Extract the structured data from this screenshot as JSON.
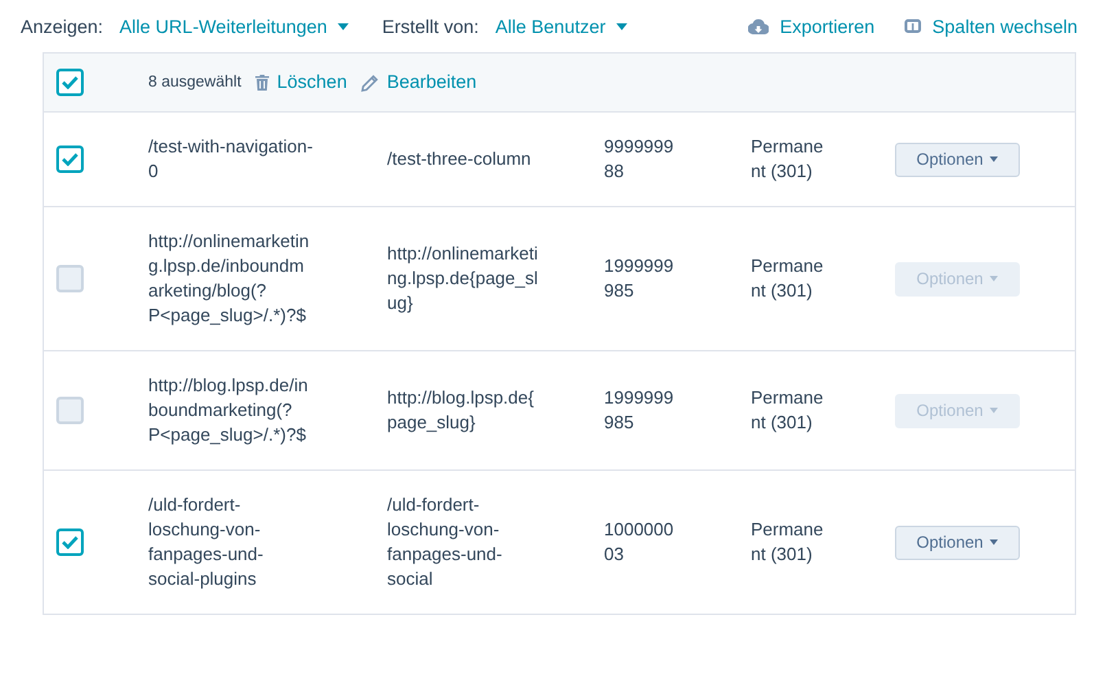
{
  "filters": [
    {
      "label": "Anzeigen:",
      "value": "Alle URL-Weiterleitungen"
    },
    {
      "label": "Erstellt von:",
      "value": "Alle Benutzer"
    }
  ],
  "actions": [
    {
      "kind": "export",
      "label": "Exportieren"
    },
    {
      "kind": "columns",
      "label": "Spalten wechseln"
    }
  ],
  "bulk_bar": {
    "checked": true,
    "count": "8 ausgewählt",
    "actions": [
      {
        "kind": "delete",
        "label": "Löschen"
      },
      {
        "kind": "edit",
        "label": "Bearbeiten"
      }
    ]
  },
  "rows": [
    {
      "checked": true,
      "source": "/test-with-navigation-0",
      "target": "/test-three-column",
      "column_3": "999999988",
      "type": "Permanent (301)",
      "button": {
        "label": "Optionen",
        "disabled": false
      }
    },
    {
      "checked": false,
      "source": "http://onlinemarketing.lpsp.de/inboundmarketing/blog(?P<page_slug>/.*)?$",
      "target": "http://onlinemarketing.lpsp.de{page_slug}",
      "column_3": "1999999985",
      "type": "Permanent (301)",
      "button": {
        "label": "Optionen",
        "disabled": true
      }
    },
    {
      "checked": false,
      "source": "http://blog.lpsp.de/inboundmarketing(?P<page_slug>/.*)?$",
      "target": "http://blog.lpsp.de{page_slug}",
      "column_3": "1999999985",
      "type": "Permanent (301)",
      "button": {
        "label": "Optionen",
        "disabled": true
      }
    },
    {
      "checked": true,
      "source": "/uld-fordert-loschung-von-fanpages-und-social-plugins",
      "target": "/uld-fordert-loschung-von-fanpages-und-social",
      "column_3": "100000003",
      "type": "Permanent (301)",
      "button": {
        "label": "Optionen",
        "disabled": false
      }
    }
  ]
}
